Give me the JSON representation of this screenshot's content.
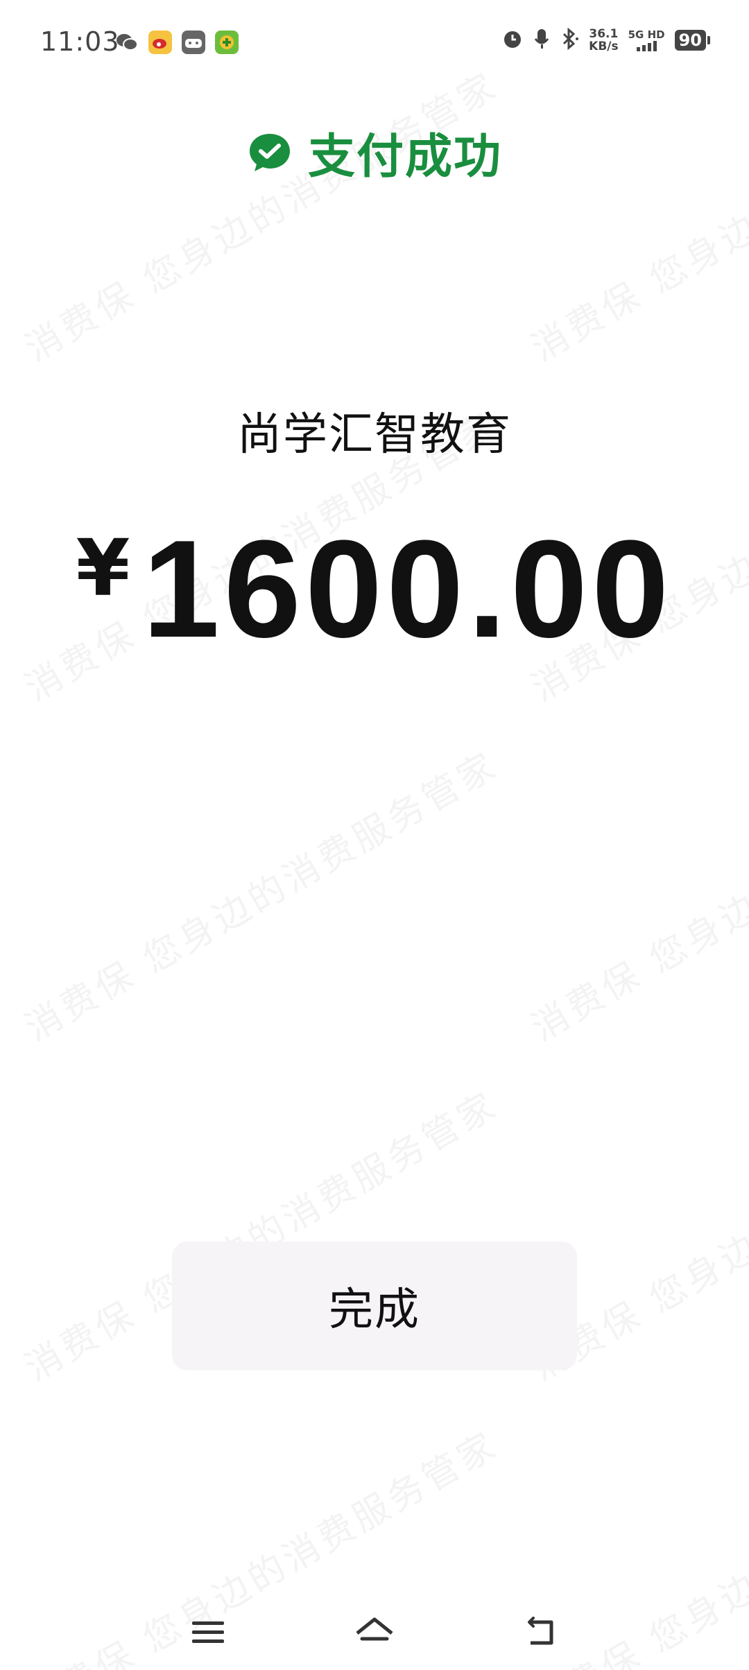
{
  "status_bar": {
    "time": "11:03",
    "net_speed_value": "36.1",
    "net_speed_unit": "KB/s",
    "network_type": "5G HD",
    "battery": "90",
    "left_icons": [
      "wechat-icon",
      "weibo-icon",
      "game-icon",
      "app-icon"
    ],
    "right_icons": [
      "alarm-icon",
      "mic-icon",
      "bluetooth-icon"
    ]
  },
  "header": {
    "title": "支付成功",
    "icon": "wechat-pay-check-icon",
    "color": "#1a8e3f"
  },
  "payment": {
    "merchant": "尚学汇智教育",
    "currency_symbol": "¥",
    "amount": "1600.00"
  },
  "actions": {
    "done_label": "完成"
  },
  "watermark": {
    "line_a": "消费保 您身边的消费服务管家"
  },
  "nav_bar": {
    "items": [
      "menu-icon",
      "home-icon",
      "back-icon"
    ]
  }
}
